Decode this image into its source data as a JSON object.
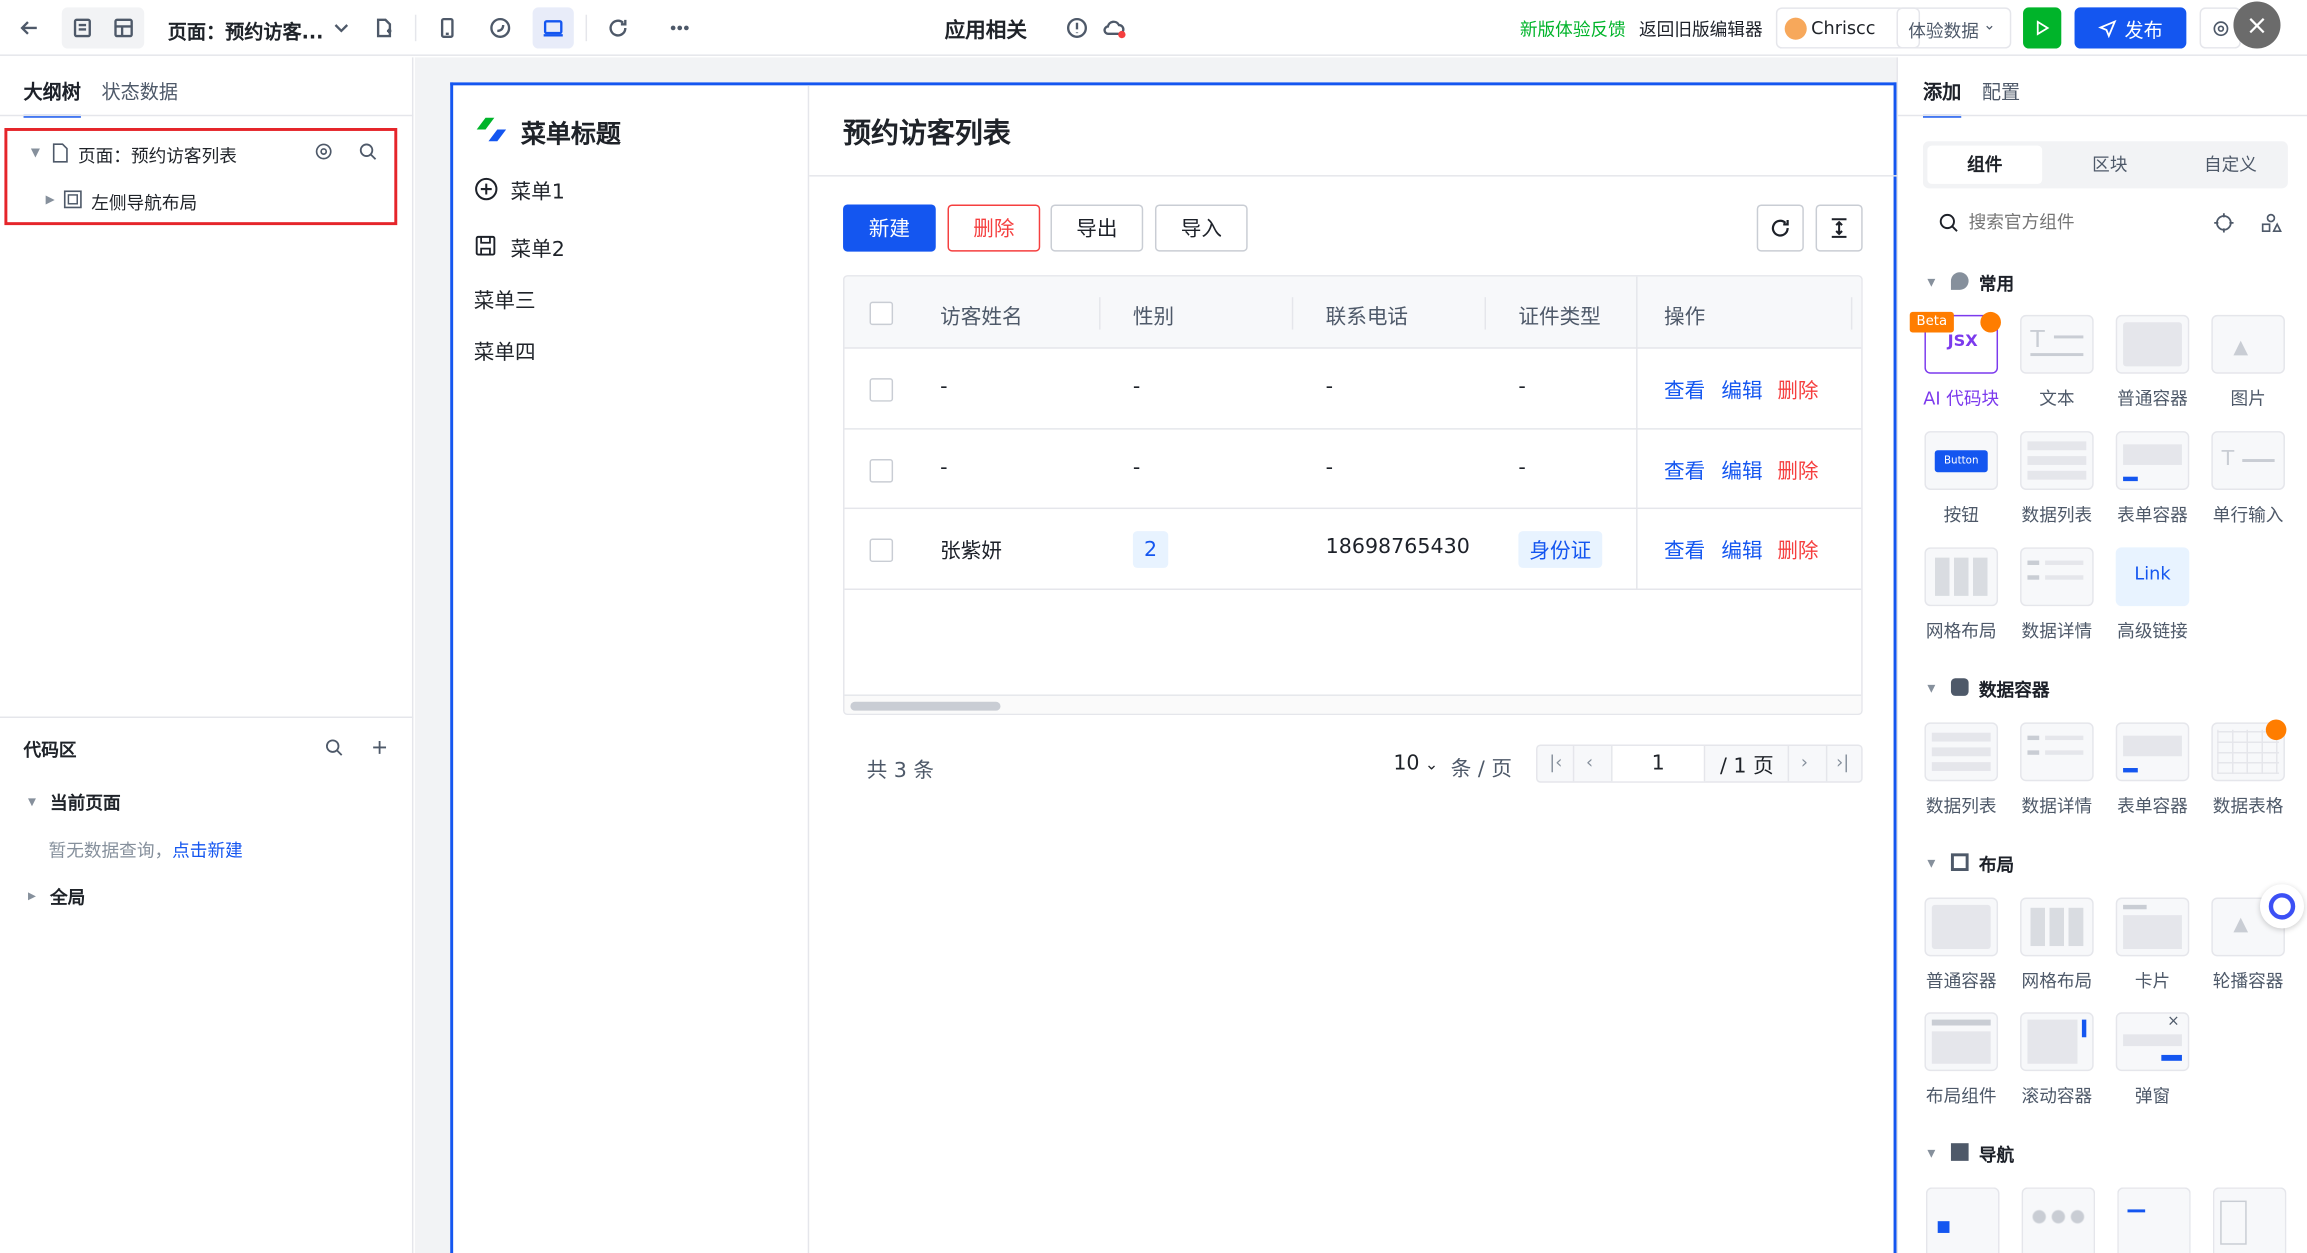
{
  "topbar": {
    "page_label": "页面：预约访客...",
    "app_title": "应用相关",
    "feedback": "新版体验反馈",
    "back_old": "返回旧版编辑器",
    "user": "Chriscc",
    "data_select": "体验数据",
    "publish": "发布"
  },
  "left_panel": {
    "tabs": [
      "大纲树",
      "状态数据"
    ],
    "tree": {
      "page": "页面：预约访客列表",
      "child": "左侧导航布局"
    },
    "code": {
      "title": "代码区",
      "current_page": "当前页面",
      "empty_text": "暂无数据查询，",
      "create_link": "点击新建",
      "global": "全局"
    }
  },
  "preview": {
    "menu_title": "菜单标题",
    "menu_items": [
      "菜单1",
      "菜单2",
      "菜单三",
      "菜单四"
    ],
    "page_title": "预约访客列表",
    "buttons": {
      "new": "新建",
      "delete": "删除",
      "export": "导出",
      "import": "导入"
    },
    "table": {
      "headers": [
        "访客姓名",
        "性别",
        "联系电话",
        "证件类型",
        "操作"
      ],
      "rows": [
        {
          "name": "-",
          "gender": "-",
          "phone": "-",
          "id_type": "-"
        },
        {
          "name": "-",
          "gender": "-",
          "phone": "-",
          "id_type": "-"
        },
        {
          "name": "张紫妍",
          "gender": "2",
          "phone": "18698765430",
          "id_type": "身份证"
        }
      ],
      "actions": {
        "view": "查看",
        "edit": "编辑",
        "delete": "删除"
      }
    },
    "pagination": {
      "total": "共 3 条",
      "page_size": "10",
      "per_page": "条 / 页",
      "current": "1",
      "pages": "/ 1 页"
    }
  },
  "right_panel": {
    "tabs": [
      "添加",
      "配置"
    ],
    "seg": [
      "组件",
      "区块",
      "自定义"
    ],
    "search_placeholder": "搜索官方组件",
    "sections": {
      "common": "常用",
      "data": "数据容器",
      "layout": "布局",
      "nav": "导航"
    },
    "common_items": [
      "AI 代码块",
      "文本",
      "普通容器",
      "图片",
      "按钮",
      "数据列表",
      "表单容器",
      "单行输入",
      "网格布局",
      "数据详情",
      "高级链接"
    ],
    "data_items": [
      "数据列表",
      "数据详情",
      "表单容器",
      "数据表格"
    ],
    "layout_items": [
      "普通容器",
      "网格布局",
      "卡片",
      "轮播容器",
      "布局组件",
      "滚动容器",
      "弹窗"
    ],
    "beta": "Beta",
    "jsx": "JSX",
    "button_mini": "Button",
    "link_mini": "Link"
  },
  "colors": {
    "primary": "#1456f0",
    "danger": "#f53f3f",
    "feedback": "#00b42a",
    "highlight": "#e8ecf9"
  }
}
